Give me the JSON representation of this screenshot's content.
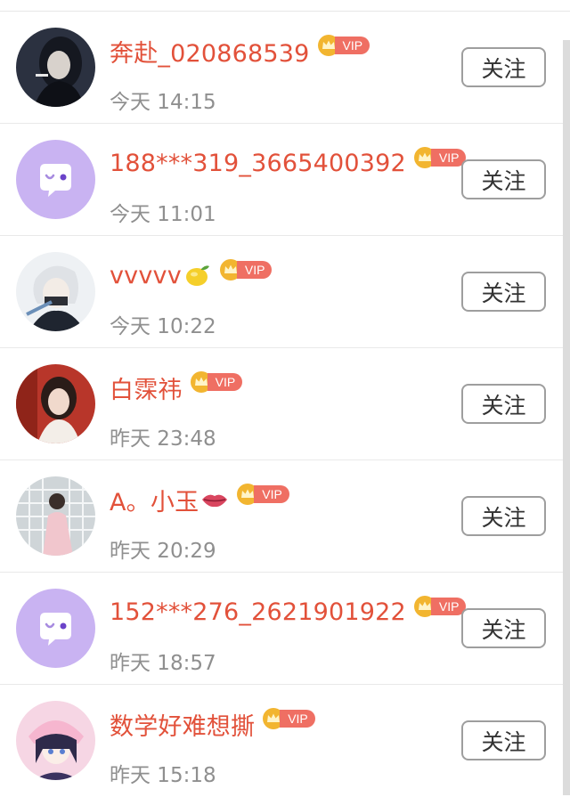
{
  "list": {
    "follow_label": "关注",
    "vip_label": "VIP",
    "items": [
      {
        "name": "奔赴_020868539",
        "time": "今天 14:15",
        "avatar": "avatar-dark-girl",
        "emoji": ""
      },
      {
        "name": "188***319_3665400392",
        "time": "今天 11:01",
        "avatar": "default-chat-avatar",
        "emoji": ""
      },
      {
        "name": "vvvvv",
        "time": "今天 10:22",
        "avatar": "avatar-anime-masked",
        "emoji": "lemon-icon"
      },
      {
        "name": "白霂祎",
        "time": "昨天 23:48",
        "avatar": "avatar-girl-red",
        "emoji": ""
      },
      {
        "name": "A。小玉",
        "time": "昨天 20:29",
        "avatar": "avatar-girl-pink-dress",
        "emoji": "lips-icon"
      },
      {
        "name": "152***276_2621901922",
        "time": "昨天 18:57",
        "avatar": "default-chat-avatar",
        "emoji": ""
      },
      {
        "name": "数学好难想撕",
        "time": "昨天 15:18",
        "avatar": "avatar-anime-pink",
        "emoji": ""
      }
    ]
  },
  "colors": {
    "name": "#e2513a",
    "time": "#8f8f8f",
    "vip_tag": "#ef6f63",
    "crown": "#f2b530",
    "default_avatar_bg": "#c9b3f2"
  }
}
